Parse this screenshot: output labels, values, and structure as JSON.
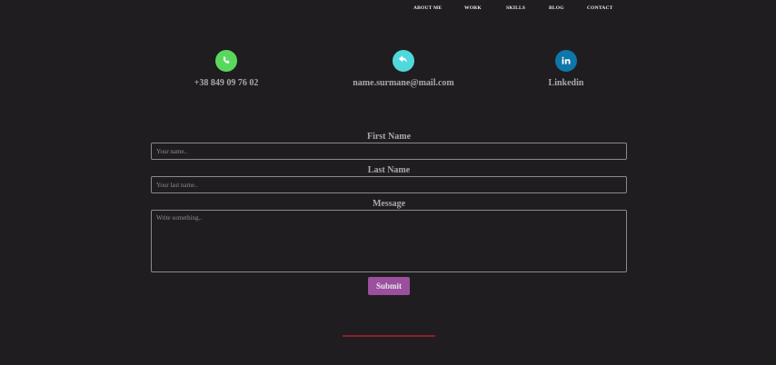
{
  "nav": {
    "items": [
      {
        "label": "ABOUT ME"
      },
      {
        "label": "WORK"
      },
      {
        "label": "SKILLS"
      },
      {
        "label": "BLOG"
      },
      {
        "label": "CONTACT"
      }
    ]
  },
  "contacts": {
    "phone": {
      "icon": "phone-icon",
      "color": "#5ad85e",
      "label": "+38 849 09 76 02"
    },
    "email": {
      "icon": "reply-arrow-icon",
      "color": "#4fd9dc",
      "label": "name.surmane@mail.com"
    },
    "linkedin": {
      "icon": "linkedin-icon",
      "color": "#0e76a8",
      "label": "Linkedin"
    }
  },
  "form": {
    "first_name": {
      "label": "First Name",
      "placeholder": "Your name.."
    },
    "last_name": {
      "label": "Last Name",
      "placeholder": "Your last name.."
    },
    "message": {
      "label": "Message",
      "placeholder": "Write something.."
    },
    "submit": {
      "label": "Submit",
      "color": "#9b4f9e"
    }
  },
  "colors": {
    "background": "#1f1d1f",
    "divider": "#8d1f2c"
  }
}
